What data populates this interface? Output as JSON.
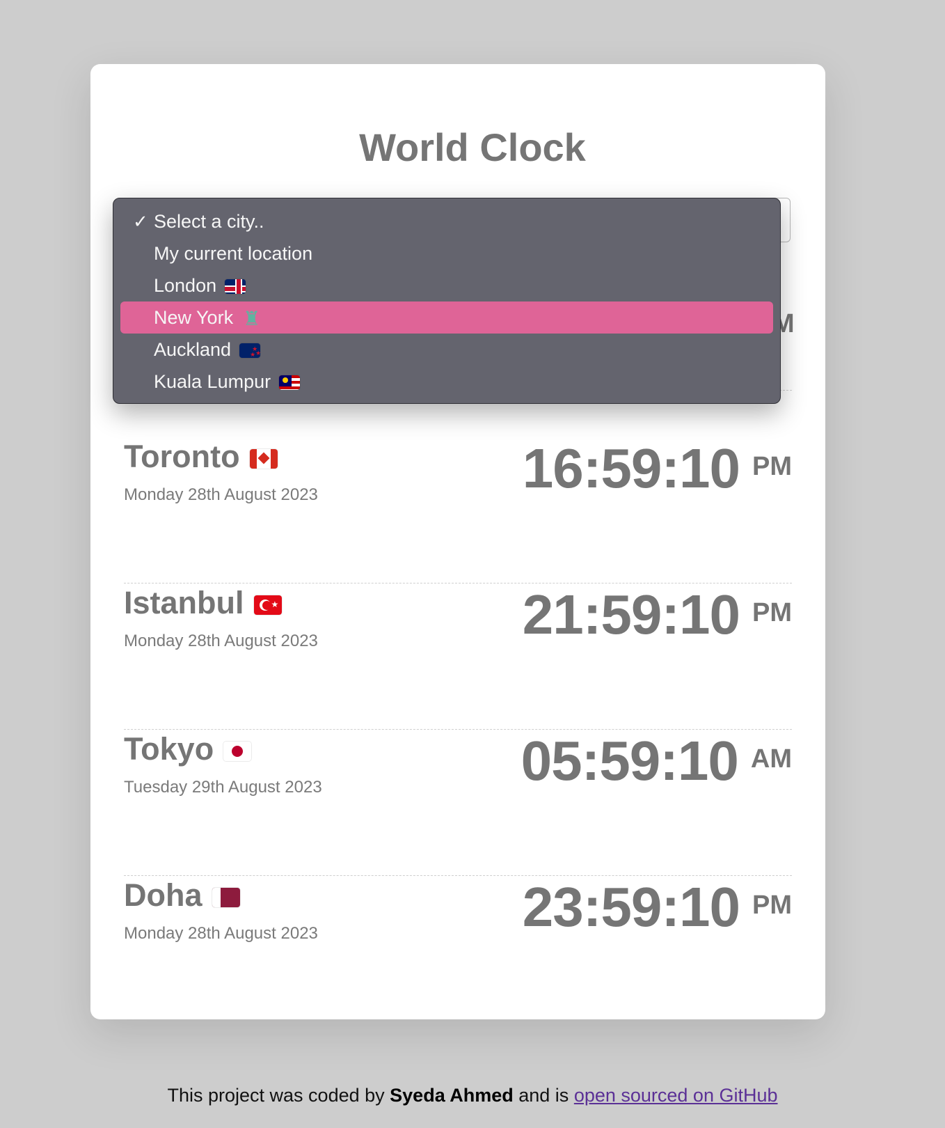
{
  "app": {
    "title": "World Clock"
  },
  "city_select": {
    "selected_value": "Select a city..",
    "options": [
      {
        "label": "Select a city..",
        "checked": true
      },
      {
        "label": "My current location"
      },
      {
        "label": "London",
        "flag": "uk-flag-icon"
      },
      {
        "label": "New York",
        "flag": "statue-of-liberty-icon",
        "highlighted": true
      },
      {
        "label": "Auckland",
        "flag": "nz-flag-icon"
      },
      {
        "label": "Kuala Lumpur",
        "flag": "malaysia-flag-icon"
      }
    ]
  },
  "cities": [
    {
      "name": "Toronto",
      "flag": "canada-flag-icon",
      "date": "Monday 28th August 2023",
      "time": "16:59:10",
      "ampm": "PM"
    },
    {
      "name": "Istanbul",
      "flag": "turkey-flag-icon",
      "date": "Monday 28th August 2023",
      "time": "21:59:10",
      "ampm": "PM"
    },
    {
      "name": "Tokyo",
      "flag": "japan-flag-icon",
      "date": "Tuesday 29th August 2023",
      "time": "05:59:10",
      "ampm": "AM"
    },
    {
      "name": "Doha",
      "flag": "qatar-flag-icon",
      "date": "Monday 28th August 2023",
      "time": "23:59:10",
      "ampm": "PM"
    }
  ],
  "hidden_row_partial": {
    "ampm": "M"
  },
  "footer": {
    "prefix": "This project was coded by",
    "author": "Syeda Ahmed",
    "middle": "and is",
    "link_text": "open sourced on GitHub"
  },
  "colors": {
    "page_bg": "#cdcdcd",
    "card_bg": "#ffffff",
    "text_gray": "#757575",
    "dropdown_bg": "#64646e",
    "highlight_pink": "#df6497",
    "link_purple": "#5b3096"
  }
}
